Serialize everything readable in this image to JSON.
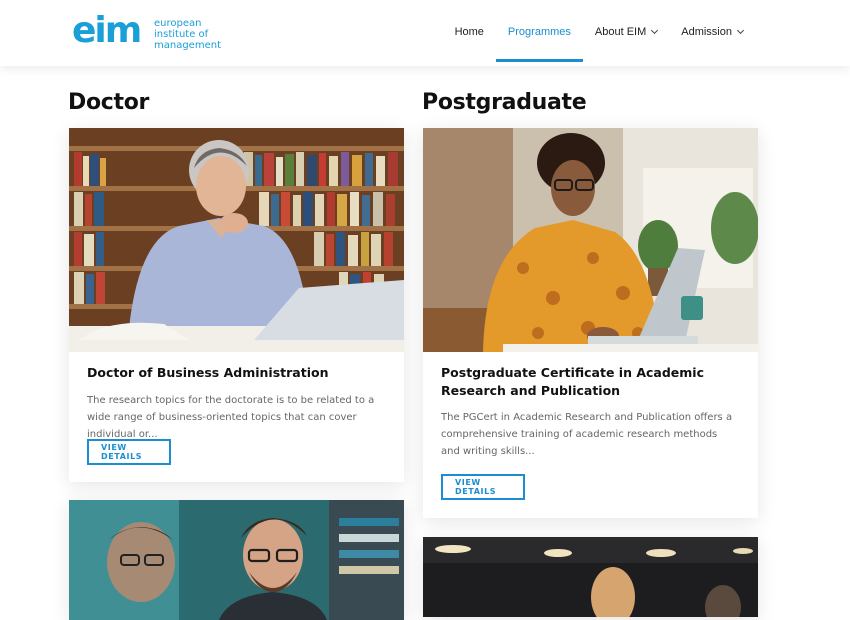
{
  "header": {
    "logo": {
      "mark": "eim",
      "text_lines": [
        "european",
        "institute of",
        "management"
      ]
    },
    "nav": [
      {
        "label": "Home",
        "active": false,
        "dropdown": false
      },
      {
        "label": "Programmes",
        "active": true,
        "dropdown": false
      },
      {
        "label": "About EIM",
        "active": false,
        "dropdown": true
      },
      {
        "label": "Admission",
        "active": false,
        "dropdown": true
      }
    ],
    "accent_color": "#1a8ed0"
  },
  "columns": [
    {
      "heading": "Doctor",
      "cards": [
        {
          "title": "Doctor of Business Administration",
          "description": "The research topics for the doctorate is to be related to a wide range of business-oriented topics that can cover individual or...",
          "button": "VIEW DETAILS",
          "image": "man-reading-library-photo"
        },
        {
          "image": "smiling-men-glasses-photo"
        }
      ]
    },
    {
      "heading": "Postgraduate",
      "cards": [
        {
          "title": "Postgraduate Certificate in Academic Research and Publication",
          "description": "The PGCert in Academic Research and Publication offers a comprehensive training of academic research methods and writing skills...",
          "button": "VIEW DETAILS",
          "image": "woman-laptop-writing-photo"
        },
        {
          "image": "office-ceiling-lights-photo"
        }
      ]
    }
  ]
}
